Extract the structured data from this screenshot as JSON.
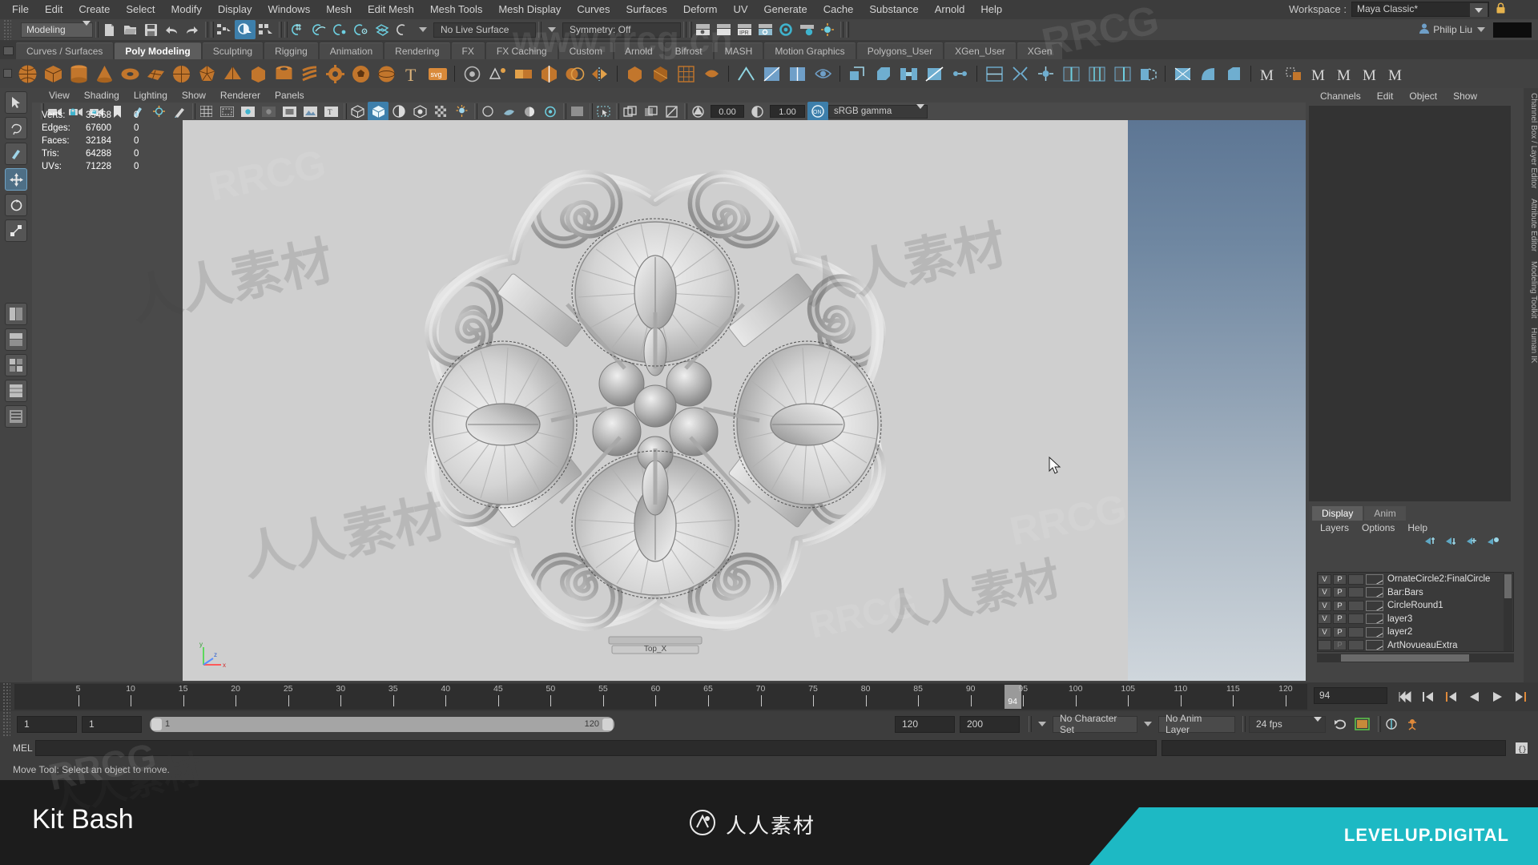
{
  "app": {
    "title": "Autodesk Maya"
  },
  "menubar": {
    "items": [
      "File",
      "Edit",
      "Create",
      "Select",
      "Modify",
      "Display",
      "Windows",
      "Mesh",
      "Edit Mesh",
      "Mesh Tools",
      "Mesh Display",
      "Curves",
      "Surfaces",
      "Deform",
      "UV",
      "Generate",
      "Cache",
      "Substance",
      "Arnold",
      "Help"
    ],
    "workspace_label": "Workspace :",
    "workspace_value": "Maya Classic*",
    "lock_icon": "lock-icon"
  },
  "statusbar": {
    "mode": "Modeling",
    "live_surface": "No Live Surface",
    "symmetry": "Symmetry: Off",
    "user_name": "Philip Liu",
    "icons": [
      "new-scene-icon",
      "open-scene-icon",
      "save-scene-icon",
      "undo-icon",
      "redo-icon",
      "select-hierarchy-icon",
      "select-object-icon",
      "select-component-icon",
      "snap-grid-icon",
      "snap-curve-icon",
      "snap-point-icon",
      "snap-projected-icon",
      "snap-view-plane-icon",
      "snap-disable-icon",
      "render-view-icon",
      "render-current-frame-icon",
      "ipr-render-icon",
      "render-settings-icon",
      "hypershade-icon",
      "render-setup-icon",
      "light-editor-icon"
    ]
  },
  "shelf": {
    "tabs": [
      "Curves / Surfaces",
      "Poly Modeling",
      "Sculpting",
      "Rigging",
      "Animation",
      "Rendering",
      "FX",
      "FX Caching",
      "Custom",
      "Arnold",
      "Bifrost",
      "MASH",
      "Motion Graphics",
      "Polygons_User",
      "XGen_User",
      "XGen"
    ],
    "active_tab": "Poly Modeling",
    "icons": [
      "poly-sphere-icon",
      "poly-cube-icon",
      "poly-cylinder-icon",
      "poly-cone-icon",
      "poly-torus-icon",
      "poly-plane-icon",
      "poly-disc-icon",
      "poly-platonic-icon",
      "poly-pyramid-icon",
      "poly-prism-icon",
      "poly-pipe-icon",
      "poly-helix-icon",
      "poly-gear-icon",
      "poly-soccer-ball-icon",
      "poly-super-ellipse-icon",
      "type-tool-icon",
      "svg-tool-icon",
      "sculpt-target-icon",
      "snap-together-icon",
      "combine-icon",
      "separate-icon",
      "boolean-icon",
      "mirror-icon",
      "smooth-icon",
      "reduce-icon",
      "remesh-icon",
      "retopologize-icon",
      "crease-icon",
      "triangulate-icon",
      "quadrangulate-icon",
      "fill-hole-icon",
      "extrude-icon",
      "bevel-icon",
      "bridge-icon",
      "multi-cut-icon",
      "target-weld-icon",
      "connect-icon",
      "detach-icon",
      "merge-icon",
      "insert-edge-loop-icon",
      "offset-edge-loop-icon",
      "slide-edge-icon",
      "append-polygon-icon",
      "poke-icon",
      "wedge-icon",
      "chamfer-vertex-icon",
      "m-tool-1-icon",
      "m-tool-2-icon",
      "m-tool-3-icon",
      "m-tool-4-icon",
      "m-tool-5-icon"
    ]
  },
  "toolbox": {
    "tools": [
      "select-tool",
      "lasso-select-tool",
      "paint-select-tool",
      "move-tool",
      "rotate-tool",
      "scale-tool",
      "last-tool-used",
      "show-manipulator-tool",
      "outliner-layout",
      "persp-outliner-layout",
      "persp-graph-layout",
      "four-view-layout",
      "persp-layout"
    ],
    "active_tool": "move-tool"
  },
  "viewport": {
    "menus": [
      "View",
      "Shading",
      "Lighting",
      "Show",
      "Renderer",
      "Panels"
    ],
    "toolbar_icons": [
      "select-camera-icon",
      "lock-camera-icon",
      "camera-attributes-icon",
      "bookmark-icon",
      "image-plane-icon",
      "2d-pan-zoom-icon",
      "grease-pencil-icon",
      "grid-icon",
      "film-gate-icon",
      "resolution-gate-icon",
      "gate-mask-icon",
      "film-origin-icon",
      "image-plane-display-icon",
      "hud-icon",
      "wireframe-icon",
      "smooth-shade-icon",
      "shaded-wireframe-icon",
      "textured-icon",
      "lighting-icon",
      "shadows-icon",
      "ambient-occlusion-icon",
      "motion-blur-icon",
      "multisample-icon",
      "depth-of-field-icon",
      "isolate-select-icon",
      "xray-icon",
      "xray-joints-icon",
      "xray-active-icon"
    ],
    "exposure": "0.00",
    "gamma": "1.00",
    "color_profile": "sRGB gamma",
    "view_label": "Top_X",
    "axis_labels": {
      "x": "x",
      "y": "y",
      "z": "z"
    },
    "hud": {
      "columns_note": "stat | total | selected | extra",
      "rows": [
        {
          "label": "Verts:",
          "total": "35468",
          "selected": "0",
          "extra": "0"
        },
        {
          "label": "Edges:",
          "total": "67600",
          "selected": "0",
          "extra": "0"
        },
        {
          "label": "Faces:",
          "total": "32184",
          "selected": "0",
          "extra": "0"
        },
        {
          "label": "Tris:",
          "total": "64288",
          "selected": "0",
          "extra": "0"
        },
        {
          "label": "UVs:",
          "total": "71228",
          "selected": "0",
          "extra": "0"
        }
      ]
    }
  },
  "right_dock": {
    "channel_menus": [
      "Channels",
      "Edit",
      "Object",
      "Show"
    ],
    "vertical_tabs": [
      "Channel Box / Layer Editor",
      "Attribute Editor",
      "Modeling Toolkit",
      "Human IK"
    ],
    "layer_editor": {
      "tabs": [
        "Display",
        "Anim"
      ],
      "active_tab": "Display",
      "menus": [
        "Layers",
        "Options",
        "Help"
      ],
      "buttons": [
        "move-layer-up-icon",
        "move-layer-down-icon",
        "new-layer-from-selected-icon",
        "new-layer-icon"
      ],
      "columns": [
        "V",
        "P"
      ],
      "layers": [
        {
          "visible": "V",
          "playback": "P",
          "name": "OrnateCircle2:FinalCircle",
          "enabled": true
        },
        {
          "visible": "V",
          "playback": "P",
          "name": "Bar:Bars",
          "enabled": true
        },
        {
          "visible": "V",
          "playback": "P",
          "name": "CircleRound1",
          "enabled": true
        },
        {
          "visible": "V",
          "playback": "P",
          "name": "layer3",
          "enabled": true
        },
        {
          "visible": "V",
          "playback": "P",
          "name": "layer2",
          "enabled": true
        },
        {
          "visible": "",
          "playback": "P",
          "name": "ArtNovueauExtra",
          "enabled": false
        }
      ]
    }
  },
  "timeline": {
    "ticks": [
      5,
      10,
      15,
      20,
      25,
      30,
      35,
      40,
      45,
      50,
      55,
      60,
      65,
      70,
      75,
      80,
      85,
      90,
      95,
      100,
      105,
      110,
      115,
      120
    ],
    "start": 1,
    "end": 120,
    "current_frame": "94",
    "playhead_label": "94",
    "transport_buttons": [
      "go-to-start-icon",
      "step-back-keyframe-icon",
      "step-back-frame-icon",
      "play-backwards-icon",
      "play-forwards-icon",
      "step-forward-frame-icon",
      "step-forward-keyframe-icon",
      "go-to-end-icon"
    ]
  },
  "range": {
    "anim_start": "1",
    "range_start": "1",
    "slider_left_label": "1",
    "slider_right_label": "120",
    "range_end": "120",
    "anim_end": "200",
    "character_set": "No Character Set",
    "anim_layer": "No Anim Layer",
    "fps": "24 fps",
    "buttons": [
      "auto-key-icon",
      "animation-preferences-icon",
      "playback-loop-icon",
      "key-tangent-icon"
    ]
  },
  "command_line": {
    "label": "MEL",
    "value": "",
    "script_editor_icon": "script-editor-icon"
  },
  "help_line": {
    "text": "Move Tool: Select an object to move."
  },
  "banner": {
    "title": "Kit Bash",
    "center_logo_text": "人人素材",
    "center_logo_icon": "rrcg-logo-icon",
    "brand": "LEVELUP.DIGITAL",
    "brand_color": "#1db9c4"
  },
  "watermarks": {
    "big": "人人素材",
    "small": "RRCG",
    "url": "www.rrcg.cn"
  },
  "colors": {
    "bg": "#3b3b3b",
    "panel": "#444444",
    "accent": "#3d7fab",
    "viewport_bg": "#cfcfcf",
    "teal": "#1db9c4"
  }
}
